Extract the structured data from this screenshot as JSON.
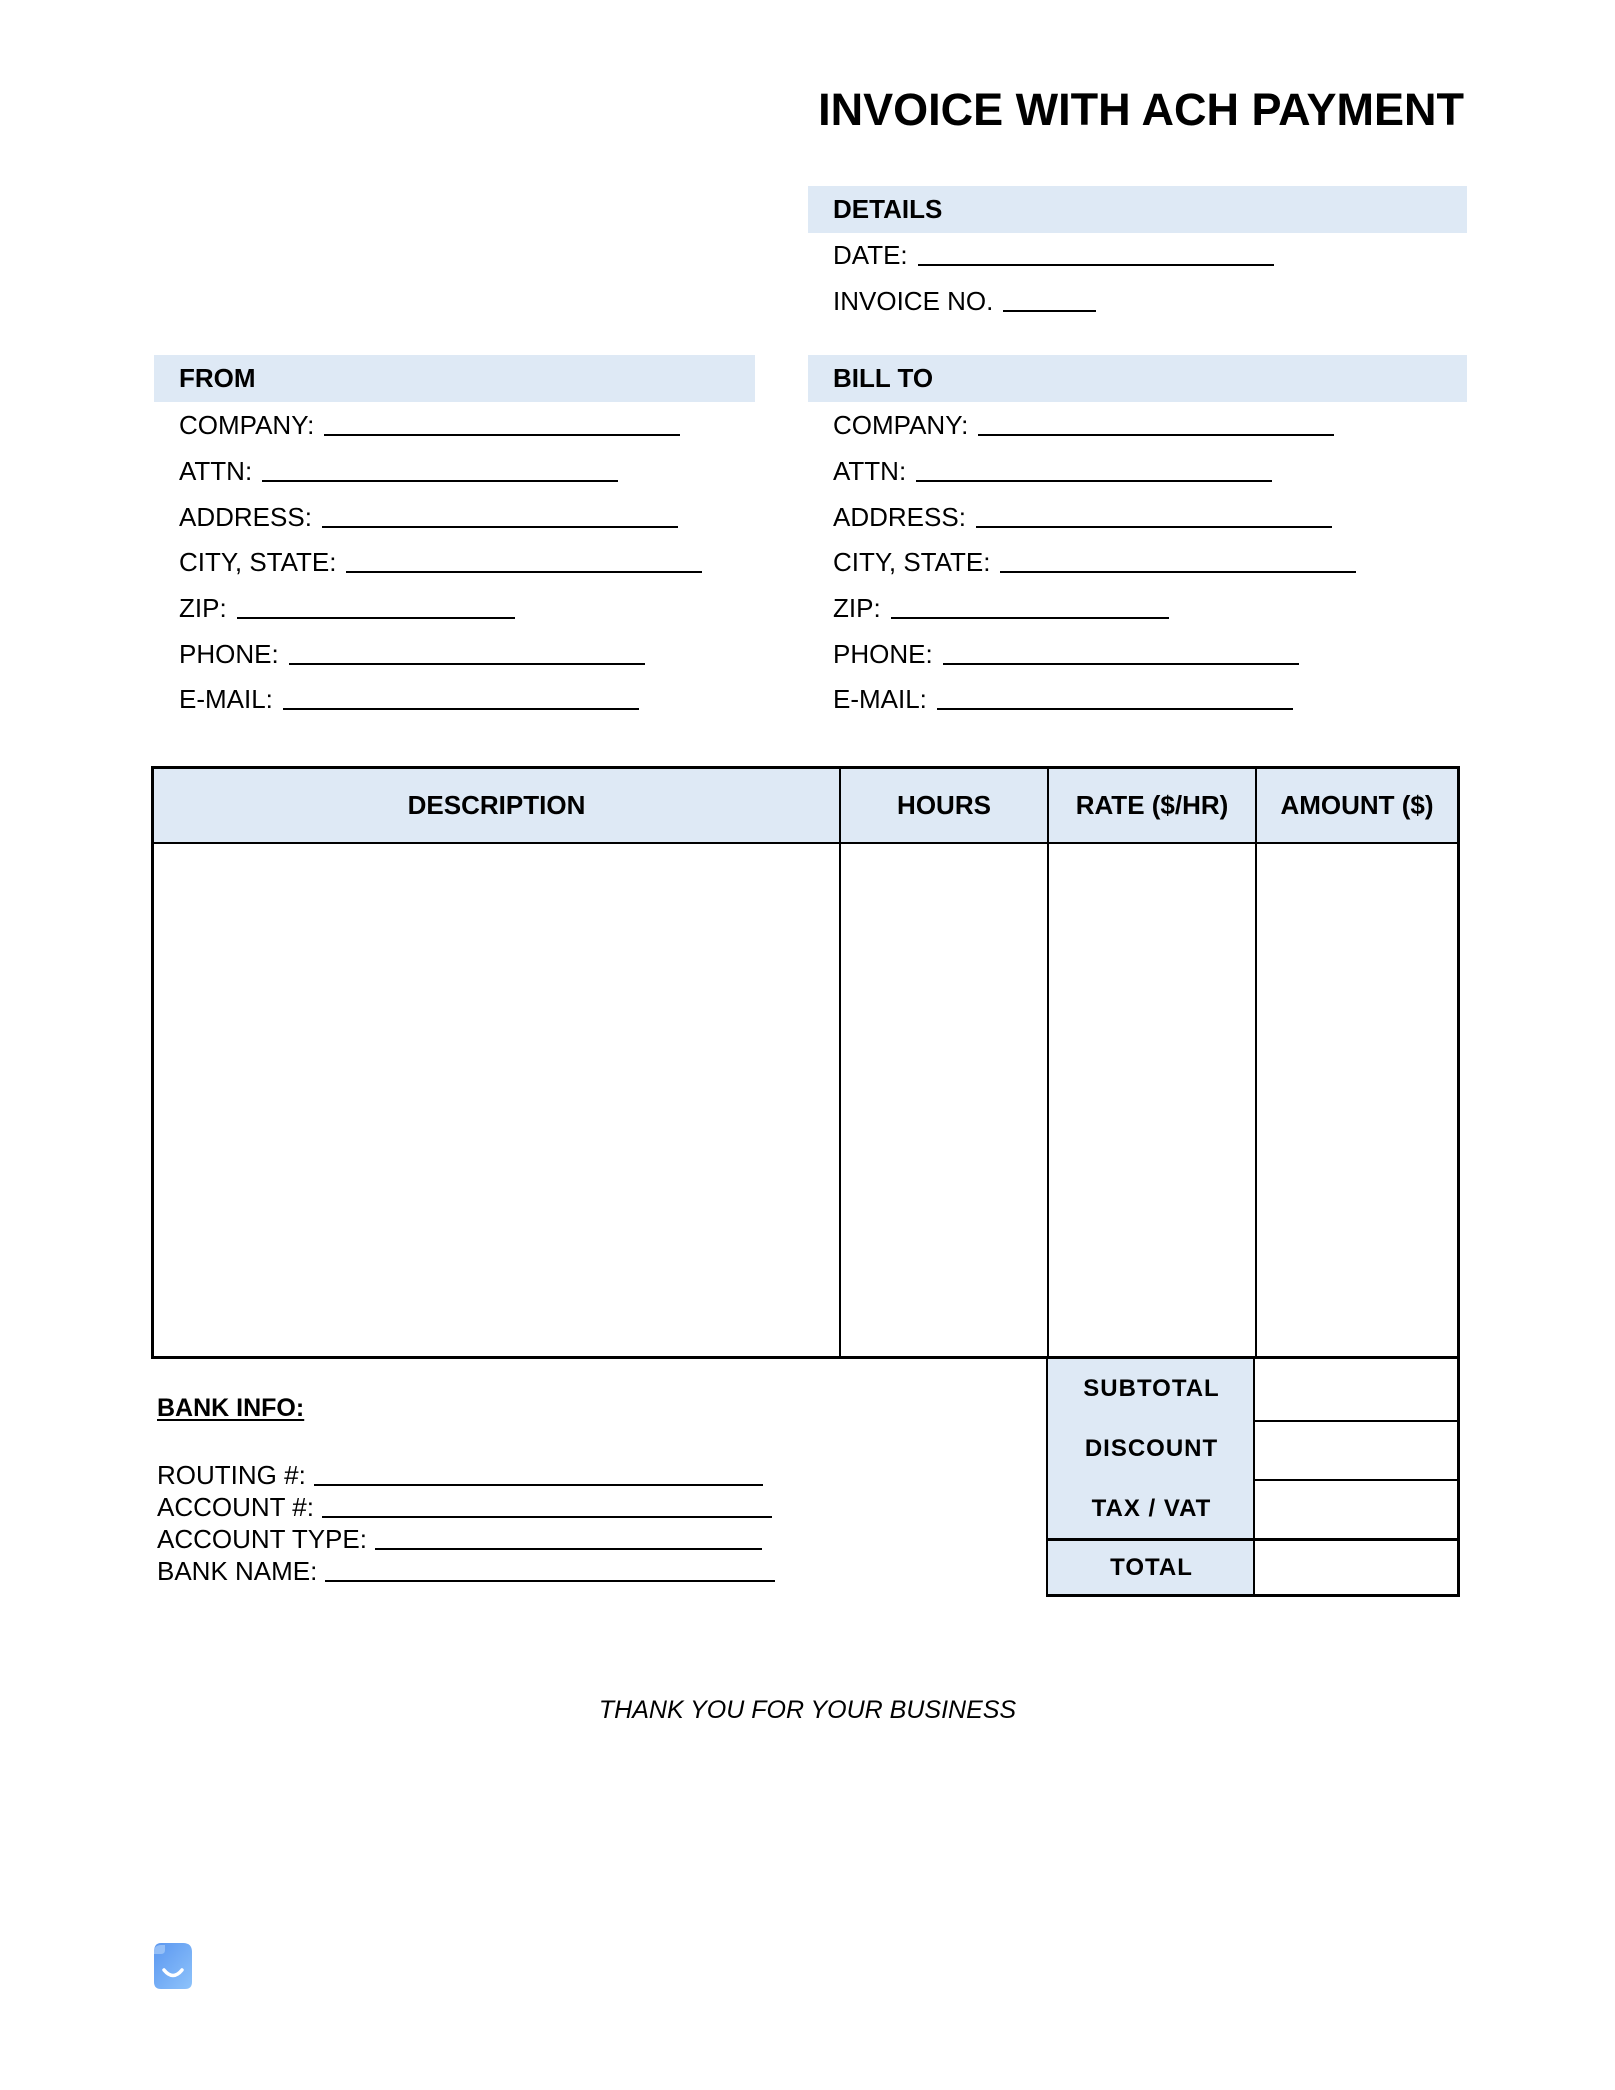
{
  "document": {
    "title": "INVOICE WITH ACH PAYMENT"
  },
  "details": {
    "heading": "DETAILS",
    "fields": [
      {
        "label": "DATE:",
        "value": ""
      },
      {
        "label": "INVOICE NO.",
        "value": ""
      }
    ]
  },
  "from": {
    "heading": "FROM",
    "fields": [
      {
        "label": "COMPANY:",
        "value": ""
      },
      {
        "label": "ATTN:",
        "value": ""
      },
      {
        "label": "ADDRESS:",
        "value": ""
      },
      {
        "label": "CITY, STATE:",
        "value": ""
      },
      {
        "label": "ZIP:",
        "value": ""
      },
      {
        "label": "PHONE:",
        "value": ""
      },
      {
        "label": "E-MAIL:",
        "value": ""
      }
    ]
  },
  "bill_to": {
    "heading": "BILL TO",
    "fields": [
      {
        "label": "COMPANY:",
        "value": ""
      },
      {
        "label": "ATTN:",
        "value": ""
      },
      {
        "label": "ADDRESS:",
        "value": ""
      },
      {
        "label": "CITY, STATE:",
        "value": ""
      },
      {
        "label": "ZIP:",
        "value": ""
      },
      {
        "label": "PHONE:",
        "value": ""
      },
      {
        "label": "E-MAIL:",
        "value": ""
      }
    ]
  },
  "line_items": {
    "columns": [
      "DESCRIPTION",
      "HOURS",
      "RATE ($/HR)",
      "AMOUNT ($)"
    ],
    "rows": []
  },
  "summary": {
    "rows": [
      {
        "label": "SUBTOTAL",
        "value": ""
      },
      {
        "label": "DISCOUNT",
        "value": ""
      },
      {
        "label": "TAX / VAT",
        "value": ""
      },
      {
        "label": "TOTAL",
        "value": ""
      }
    ]
  },
  "bank_info": {
    "heading": "BANK INFO:",
    "fields": [
      {
        "label": "ROUTING #:",
        "value": ""
      },
      {
        "label": "ACCOUNT #:",
        "value": ""
      },
      {
        "label": "ACCOUNT TYPE:",
        "value": ""
      },
      {
        "label": "BANK NAME:",
        "value": ""
      }
    ]
  },
  "footer": {
    "message": "THANK YOU FOR YOUR BUSINESS",
    "logo_icon": "document-smile-icon"
  },
  "colors": {
    "header_fill": "#DEE9F5",
    "text": "#000000",
    "logo_blue": "#6FA8F5"
  }
}
